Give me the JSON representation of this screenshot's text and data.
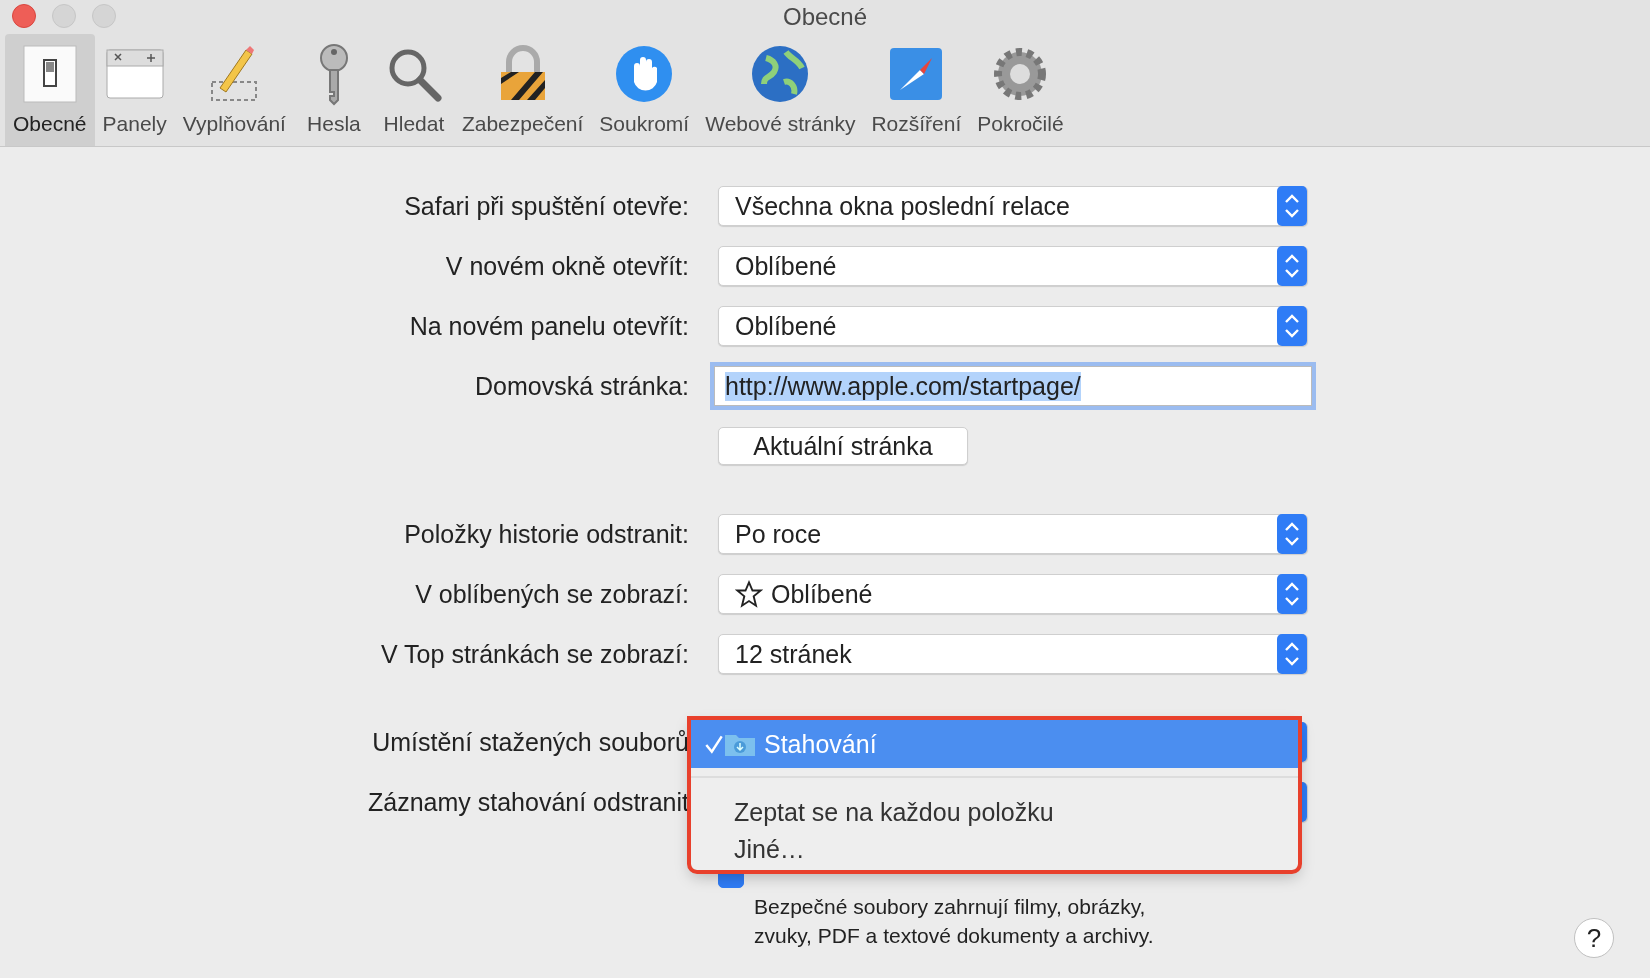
{
  "window": {
    "title": "Obecné"
  },
  "toolbar": {
    "items": [
      {
        "label": "Obecné",
        "selected": true
      },
      {
        "label": "Panely",
        "selected": false
      },
      {
        "label": "Vyplňování",
        "selected": false
      },
      {
        "label": "Hesla",
        "selected": false
      },
      {
        "label": "Hledat",
        "selected": false
      },
      {
        "label": "Zabezpečení",
        "selected": false
      },
      {
        "label": "Soukromí",
        "selected": false
      },
      {
        "label": "Webové stránky",
        "selected": false
      },
      {
        "label": "Rozšíření",
        "selected": false
      },
      {
        "label": "Pokročilé",
        "selected": false
      }
    ]
  },
  "sections": [
    {
      "rows": [
        {
          "kind": "select",
          "label": "Safari při spuštění otevře:",
          "value": "Všechna okna poslední relace"
        },
        {
          "kind": "select",
          "label": "V novém okně otevřít:",
          "value": "Oblíbené"
        },
        {
          "kind": "select",
          "label": "Na novém panelu otevřít:",
          "value": "Oblíbené"
        },
        {
          "kind": "text",
          "label": "Domovská stránka:",
          "value": "http://www.apple.com/startpage/",
          "focused": true,
          "text_selected": true
        },
        {
          "kind": "button",
          "value": "Aktuální stránka"
        }
      ]
    },
    {
      "rows": [
        {
          "kind": "select",
          "label": "Položky historie odstranit:",
          "value": "Po roce"
        },
        {
          "kind": "select",
          "label": "V oblíbených se zobrazí:",
          "value": "Oblíbené",
          "icon": true
        },
        {
          "kind": "select",
          "label": "V Top stránkách se zobrazí:",
          "value": "12 stránek"
        }
      ]
    },
    {
      "rows": [
        {
          "kind": "select",
          "label": "Umístění stažených souborů"
        },
        {
          "kind": "select",
          "label": "Záznamy stahování odstranit"
        },
        {
          "kind": "checkbox",
          "checked": true,
          "note": "Bezpečné soubory zahrnují filmy, obrázky,\nzvuky, PDF a textové dokumenty a archivy."
        }
      ]
    }
  ],
  "popup_menu": {
    "highlighted": true,
    "items": [
      {
        "label": "Stahování",
        "selected": true,
        "icon": true,
        "separator_after": true
      },
      {
        "label": "Zeptat se na každou položku",
        "selected": false
      },
      {
        "label": "Jiné…",
        "selected": false
      }
    ]
  },
  "help_button": {
    "label": "?"
  }
}
